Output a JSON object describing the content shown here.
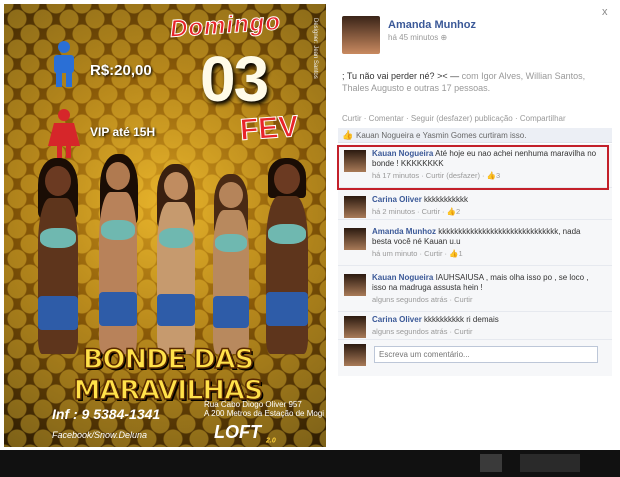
{
  "poster": {
    "price": "R$:20,00",
    "vip": "VIP até 15H",
    "domingo": "Domingo",
    "day": "03",
    "month": "FEV",
    "designer": "Designer: Jean Santos",
    "title": "BONDE DAS MARAVILHAS",
    "info": "Inf : 9 5384-1341",
    "facebook": "Facebook/Snow.Deluna",
    "address_line1": "Rua Cabo Diogo Oliver 957",
    "address_line2": "A 200 Metros da Estação de Mogi",
    "logo": "LOFT",
    "logo_version": "2.0"
  },
  "post": {
    "author": "Amanda Munhoz",
    "time": "há 45 minutos",
    "text": "; Tu não vai perder né? >< —",
    "with_text": "com Igor Alves, Willian Santos, Thales Augusto e outras 17 pessoas.",
    "actions": "Curtir · Comentar · Seguir (desfazer) publicação · Compartilhar",
    "likes": "Kauan Nogueira e Yasmin Gomes curtiram isso.",
    "close": "x"
  },
  "comments": [
    {
      "name": "Kauan Nogueira",
      "text": "Até hoje eu nao achei nenhuma maravilha no bonde ! KKKKKKKK",
      "meta": "há 17 minutos · Curtir (desfazer) ·",
      "likes": "3"
    },
    {
      "name": "Carina Oliver",
      "text": "kkkkkkkkkkk",
      "meta": "há 2 minutos · Curtir ·",
      "likes": "2"
    },
    {
      "name": "Amanda Munhoz",
      "text": "kkkkkkkkkkkkkkkkkkkkkkkkkkkkkk, nada besta você né Kauan u.u",
      "meta": "há um minuto · Curtir ·",
      "likes": "1"
    },
    {
      "name": "Kauan Nogueira",
      "text": "IAUHSAIUSA , mais olha isso po , se loco , isso na madruga assusta hein !",
      "meta": "alguns segundos atrás · Curtir",
      "likes": ""
    },
    {
      "name": "Carina Oliver",
      "text": "kkkkkkkkkk ri demais",
      "meta": "alguns segundos atrás · Curtir",
      "likes": ""
    }
  ],
  "comment_input": {
    "placeholder": "Escreva um comentário..."
  }
}
